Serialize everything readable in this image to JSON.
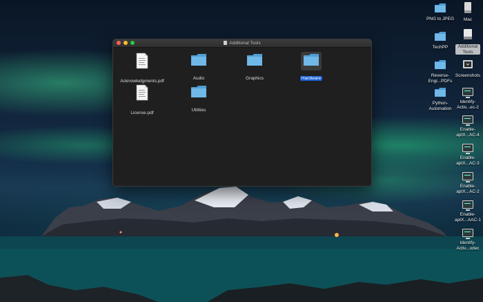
{
  "window": {
    "title": "Additional Tools",
    "items": [
      {
        "label": "Acknowledgments.pdf",
        "type": "pdf",
        "selected": false
      },
      {
        "label": "Audio",
        "type": "folder",
        "selected": false
      },
      {
        "label": "Graphics",
        "type": "folder",
        "selected": false
      },
      {
        "label": "Hardware",
        "type": "folder",
        "selected": true
      },
      {
        "label": "License.pdf",
        "type": "pdf",
        "selected": false
      },
      {
        "label": "Utilities",
        "type": "folder",
        "selected": false
      }
    ]
  },
  "desktop": {
    "icons": [
      {
        "label": "PNG to JPEG",
        "type": "folder"
      },
      {
        "label": "Mac",
        "type": "drive"
      },
      {
        "label": "TechPP",
        "type": "folder"
      },
      {
        "label": "Additional Tools",
        "type": "disk-image",
        "selected": true
      },
      {
        "label": "Reverse-Engi...PDFs",
        "type": "folder"
      },
      {
        "label": "Screenshots",
        "type": "screenshots"
      },
      {
        "label": "Python-Automation",
        "type": "folder"
      },
      {
        "label": "Identify-Activ...ec-2",
        "type": "screen"
      },
      {
        "label": "Enable-aptX...AC-4",
        "type": "screen"
      },
      {
        "label": "Enable-aptX...AC-3",
        "type": "screen"
      },
      {
        "label": "Enable-aptX...AC-2",
        "type": "screen"
      },
      {
        "label": "Enable-aptX...AAC-1",
        "type": "screen"
      },
      {
        "label": "Identify-Activ...odec",
        "type": "screen"
      }
    ]
  },
  "colors": {
    "folder": "#6fb8e8",
    "folder_dark": "#4e9fd6",
    "selection": "#1a5fd6"
  }
}
